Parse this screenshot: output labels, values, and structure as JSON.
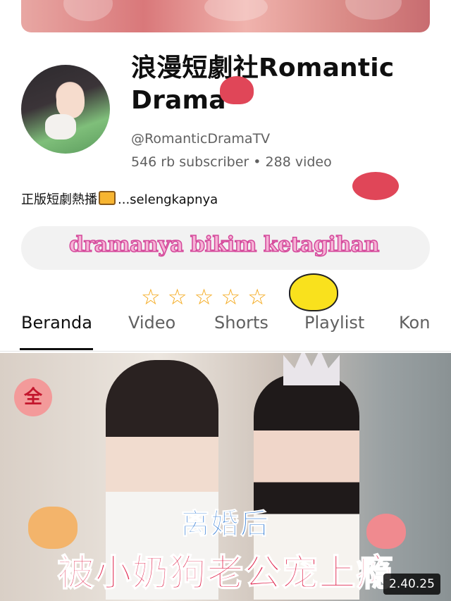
{
  "channel": {
    "name": "浪漫短劇社Romantic Drama",
    "handle": "@RomanticDramaTV",
    "subscribers": "546 rb subscriber",
    "separator": "•",
    "videos": "288 video",
    "description": "正版短劇熱播",
    "more": "...selengkapnya"
  },
  "sticker": {
    "text": "dramanya bikim ketagihan",
    "stars": [
      "☆",
      "☆",
      "☆",
      "☆",
      "☆"
    ]
  },
  "tabs": [
    {
      "label": "Beranda",
      "active": true
    },
    {
      "label": "Video",
      "active": false
    },
    {
      "label": "Shorts",
      "active": false
    },
    {
      "label": "Playlist",
      "active": false
    },
    {
      "label": "Kon",
      "active": false
    }
  ],
  "video": {
    "badge": "全",
    "title_line1": "离婚后",
    "title_line2": "被小奶狗老公宠上瘾",
    "duration": "2.40.25"
  },
  "colors": {
    "accent_pink": "#d4479a",
    "star": "#f4a81a",
    "title_blue": "#1f6fd1",
    "title_red": "#e0264e"
  },
  "icons": {
    "tv": "tv-icon",
    "star": "star-icon",
    "crown": "crown-icon",
    "lips": "lips-icon"
  }
}
